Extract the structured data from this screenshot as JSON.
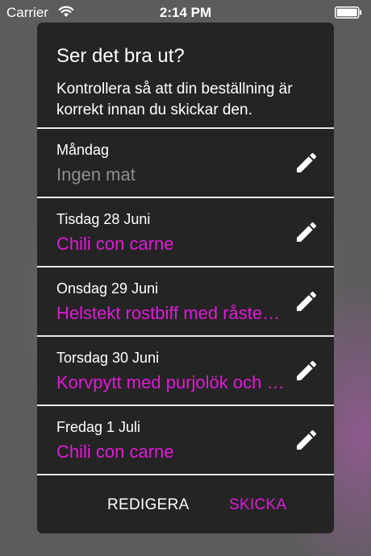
{
  "status_bar": {
    "carrier": "Carrier",
    "time": "2:14 PM"
  },
  "dialog": {
    "title": "Ser det bra ut?",
    "message": "Kontrollera så att din beställning är korrekt innan du skickar den.",
    "items": [
      {
        "day": "Måndag",
        "meal": "Ingen mat",
        "empty": true
      },
      {
        "day": "Tisdag 28 Juni",
        "meal": "Chili con carne",
        "empty": false
      },
      {
        "day": "Onsdag 29 Juni",
        "meal": "Helstekt rostbiff med råstekt potatis",
        "empty": false
      },
      {
        "day": "Torsdag 30 Juni",
        "meal": "Korvpytt med purjolök och ägg",
        "empty": false
      },
      {
        "day": "Fredag 1 Juli",
        "meal": "Chili con carne",
        "empty": false
      }
    ],
    "actions": {
      "edit_label": "REDIGERA",
      "send_label": "SKICKA"
    }
  },
  "colors": {
    "accent": "#e21ad8",
    "dialog_background": "#242425",
    "placeholder_text": "#8e8e8e"
  },
  "icons": {
    "edit": "pencil-icon",
    "wifi": "wifi-icon",
    "battery": "battery-icon"
  }
}
